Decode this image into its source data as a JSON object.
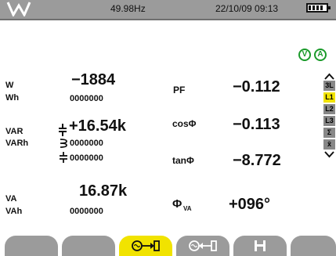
{
  "status": {
    "logo": "W",
    "frequency": "49.98Hz",
    "datetime": "22/10/09 09:13",
    "battery_icon": "battery-icon"
  },
  "indicators": {
    "v": "V",
    "a": "A"
  },
  "measurements": {
    "w_label": "W",
    "w_value": "−1884",
    "wh_label": "Wh",
    "wh_value": "0000000",
    "var_label": "VAR",
    "var_value": "+16.54k",
    "varh_label": "VARh",
    "varh_value_1": "0000000",
    "varh_value_2": "0000000",
    "va_label": "VA",
    "va_value": "16.87k",
    "vah_label": "VAh",
    "vah_value": "0000000",
    "pf_label": "PF",
    "pf_value": "−0.112",
    "cos_label": "cosΦ",
    "cos_value": "−0.113",
    "tan_label": "tanΦ",
    "tan_value": "−8.772",
    "phi_label": "Φ",
    "phi_sub": "VA",
    "phi_value": "+096°"
  },
  "sidebar": {
    "items": [
      "3L",
      "L1",
      "L2",
      "L3",
      "Σ",
      "x̄"
    ],
    "selected": "L1"
  },
  "colors": {
    "topbar": "#9b9b9b",
    "accent": "#f1e300",
    "indicator": "#1a9a2a"
  },
  "softkeys": [
    "blank",
    "blank",
    "energy-consumed-icon",
    "energy-generated-icon",
    "save-icon",
    "blank"
  ]
}
